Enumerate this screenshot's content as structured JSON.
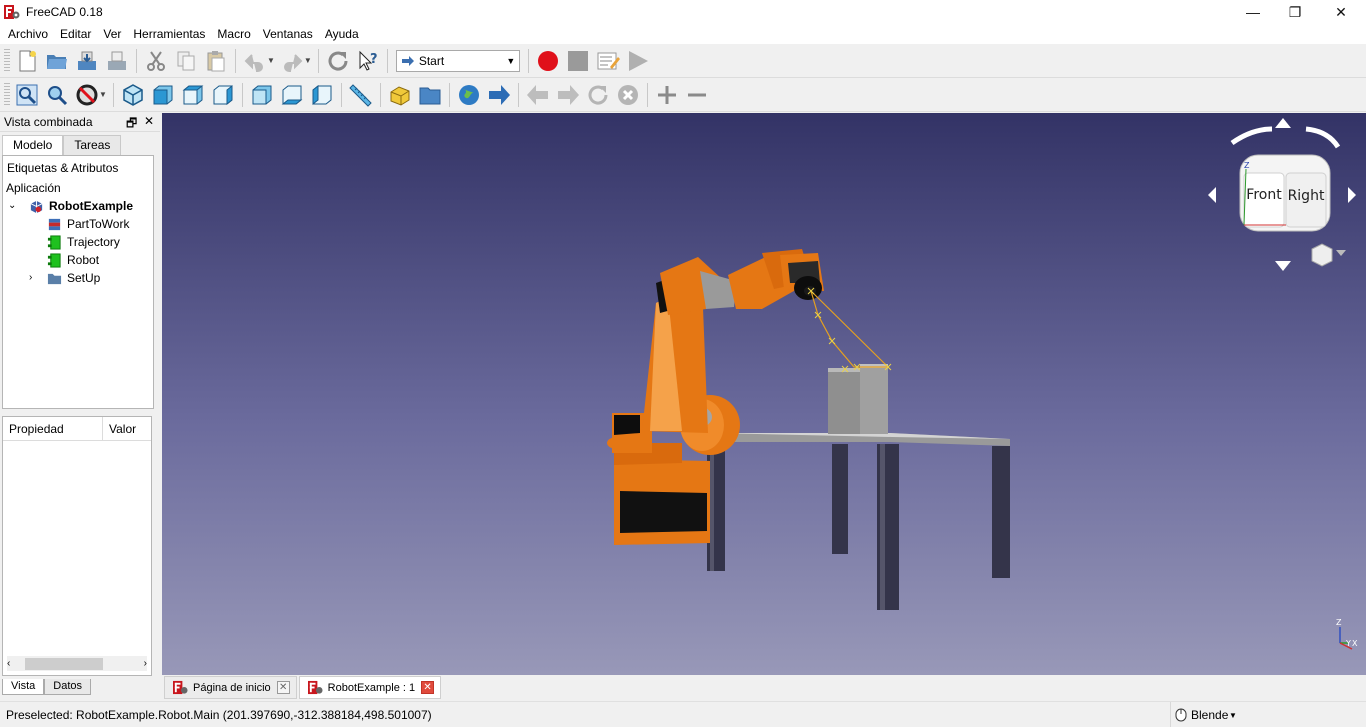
{
  "window": {
    "title": "FreeCAD 0.18",
    "minimize": "—",
    "restore": "❐",
    "close": "✕"
  },
  "menu": [
    "Archivo",
    "Editar",
    "Ver",
    "Herramientas",
    "Macro",
    "Ventanas",
    "Ayuda"
  ],
  "toolbar": {
    "workbench": "Start"
  },
  "combo": {
    "title": "Vista combinada",
    "tabs": [
      "Modelo",
      "Tareas"
    ],
    "tree_header": "Etiquetas & Atributos",
    "tree_section": "Aplicación",
    "tree": [
      {
        "label": "RobotExample",
        "icon": "document-icon"
      },
      {
        "label": "PartToWork",
        "icon": "part-icon"
      },
      {
        "label": "Trajectory",
        "icon": "trajectory-icon"
      },
      {
        "label": "Robot",
        "icon": "robot-icon"
      },
      {
        "label": "SetUp",
        "icon": "folder-icon"
      }
    ],
    "prop_headers": [
      "Propiedad",
      "Valor"
    ],
    "bottom_tabs": [
      "Vista",
      "Datos"
    ]
  },
  "navcube": {
    "front": "Front",
    "right": "Right"
  },
  "axes": {
    "z": "Z",
    "y": "Y",
    "x": "X"
  },
  "doc_tabs": [
    {
      "label": "Página de inicio",
      "active": false
    },
    {
      "label": "RobotExample : 1",
      "active": true
    }
  ],
  "status": {
    "text": "Preselected: RobotExample.Robot.Main (201.397690,-312.388184,498.501007)",
    "nav": "Blender"
  },
  "colors": {
    "robot": "#e57714",
    "bg_top": "#333366",
    "bg_bottom": "#9898b8",
    "record": "#e0101a"
  }
}
